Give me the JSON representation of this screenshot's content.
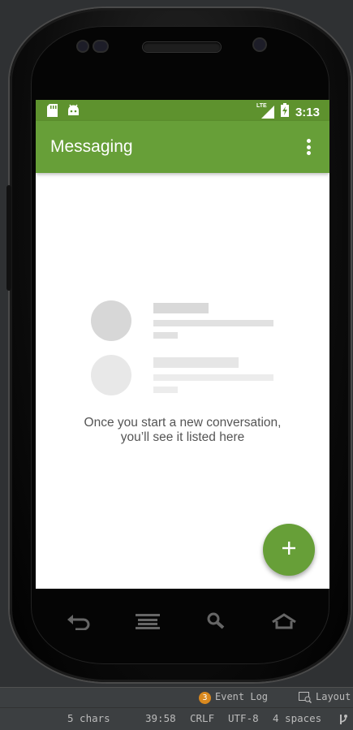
{
  "status_bar": {
    "time": "3:13",
    "network": "LTE",
    "icons": [
      "sd-card-icon",
      "android-icon",
      "signal-icon",
      "battery-charging-icon"
    ]
  },
  "toolbar": {
    "title": "Messaging",
    "overflow_icon": "more-vert-icon"
  },
  "empty_state": {
    "message": "Once you start a new conversation, you’ll see it listed here"
  },
  "fab": {
    "icon": "plus-icon"
  },
  "nav_buttons": [
    "back-icon",
    "menu-icon",
    "search-icon",
    "home-icon"
  ],
  "ide_status": {
    "event_log_count": "3",
    "event_log_label": "Event Log",
    "layout_label": "Layout",
    "chars": "5 chars",
    "position": "39:58",
    "line_ending": "CRLF",
    "encoding": "UTF-8",
    "indent": "4 spaces"
  },
  "colors": {
    "status_bar": "#5e922e",
    "toolbar": "#679f38",
    "fab": "#679f38",
    "placeholder_dark": "#d7d7d7",
    "placeholder_light": "#e8e8e8"
  }
}
